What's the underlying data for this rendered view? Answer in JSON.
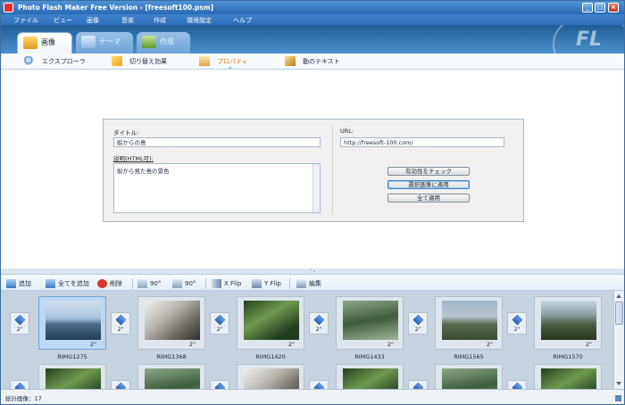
{
  "window": {
    "title": "Photo Flash Maker Free Version - [freesoft100.psm]"
  },
  "menu": [
    "ファイル",
    "ビュー",
    "画像",
    "音楽",
    "作成",
    "環境設定",
    "ヘルプ"
  ],
  "tabs": [
    {
      "label": "画像",
      "icon": "image-tab-icon",
      "active": true
    },
    {
      "label": "テーマ",
      "icon": "theme-tab-icon",
      "active": false
    },
    {
      "label": "作成",
      "icon": "create-tab-icon",
      "active": false
    }
  ],
  "subtabs": [
    "エクスプローラ",
    "切り替え効果",
    "プロパティ",
    "動のテキスト"
  ],
  "properties": {
    "title_label": "タイトル:",
    "title_value": "船からの島",
    "desc_label": "説明(HTML可):",
    "desc_value": "船から見た島の景色",
    "url_label": "URL:",
    "url_value": "http://freesoft-100.com/",
    "check_button": "有効性をチェック",
    "apply_selected_button": "選択画像に適用",
    "apply_all_button": "全て適用"
  },
  "image_toolbar": {
    "add": "追加",
    "add_all": "全てを追加",
    "delete": "削除",
    "rotate_left": "90°",
    "rotate_right": "90°",
    "xflip": "X Flip",
    "yflip": "Y Flip",
    "edit": "編集"
  },
  "filmstrip": {
    "transition_duration": "2\"",
    "photos": [
      {
        "name": "RIMG1275",
        "duration": "2\"",
        "selected": true
      },
      {
        "name": "RIMG1368",
        "duration": "2\""
      },
      {
        "name": "RIMG1420",
        "duration": "2\""
      },
      {
        "name": "RIMG1433",
        "duration": "2\""
      },
      {
        "name": "RIMG1565",
        "duration": "2\""
      },
      {
        "name": "RIMG1570",
        "duration": "2\""
      }
    ]
  },
  "status": {
    "text": "総計画像：17"
  },
  "colors": {
    "accent": "#2a69b3",
    "active_subtab": "#e07b00",
    "selected_slot": "#bcd8f5"
  }
}
